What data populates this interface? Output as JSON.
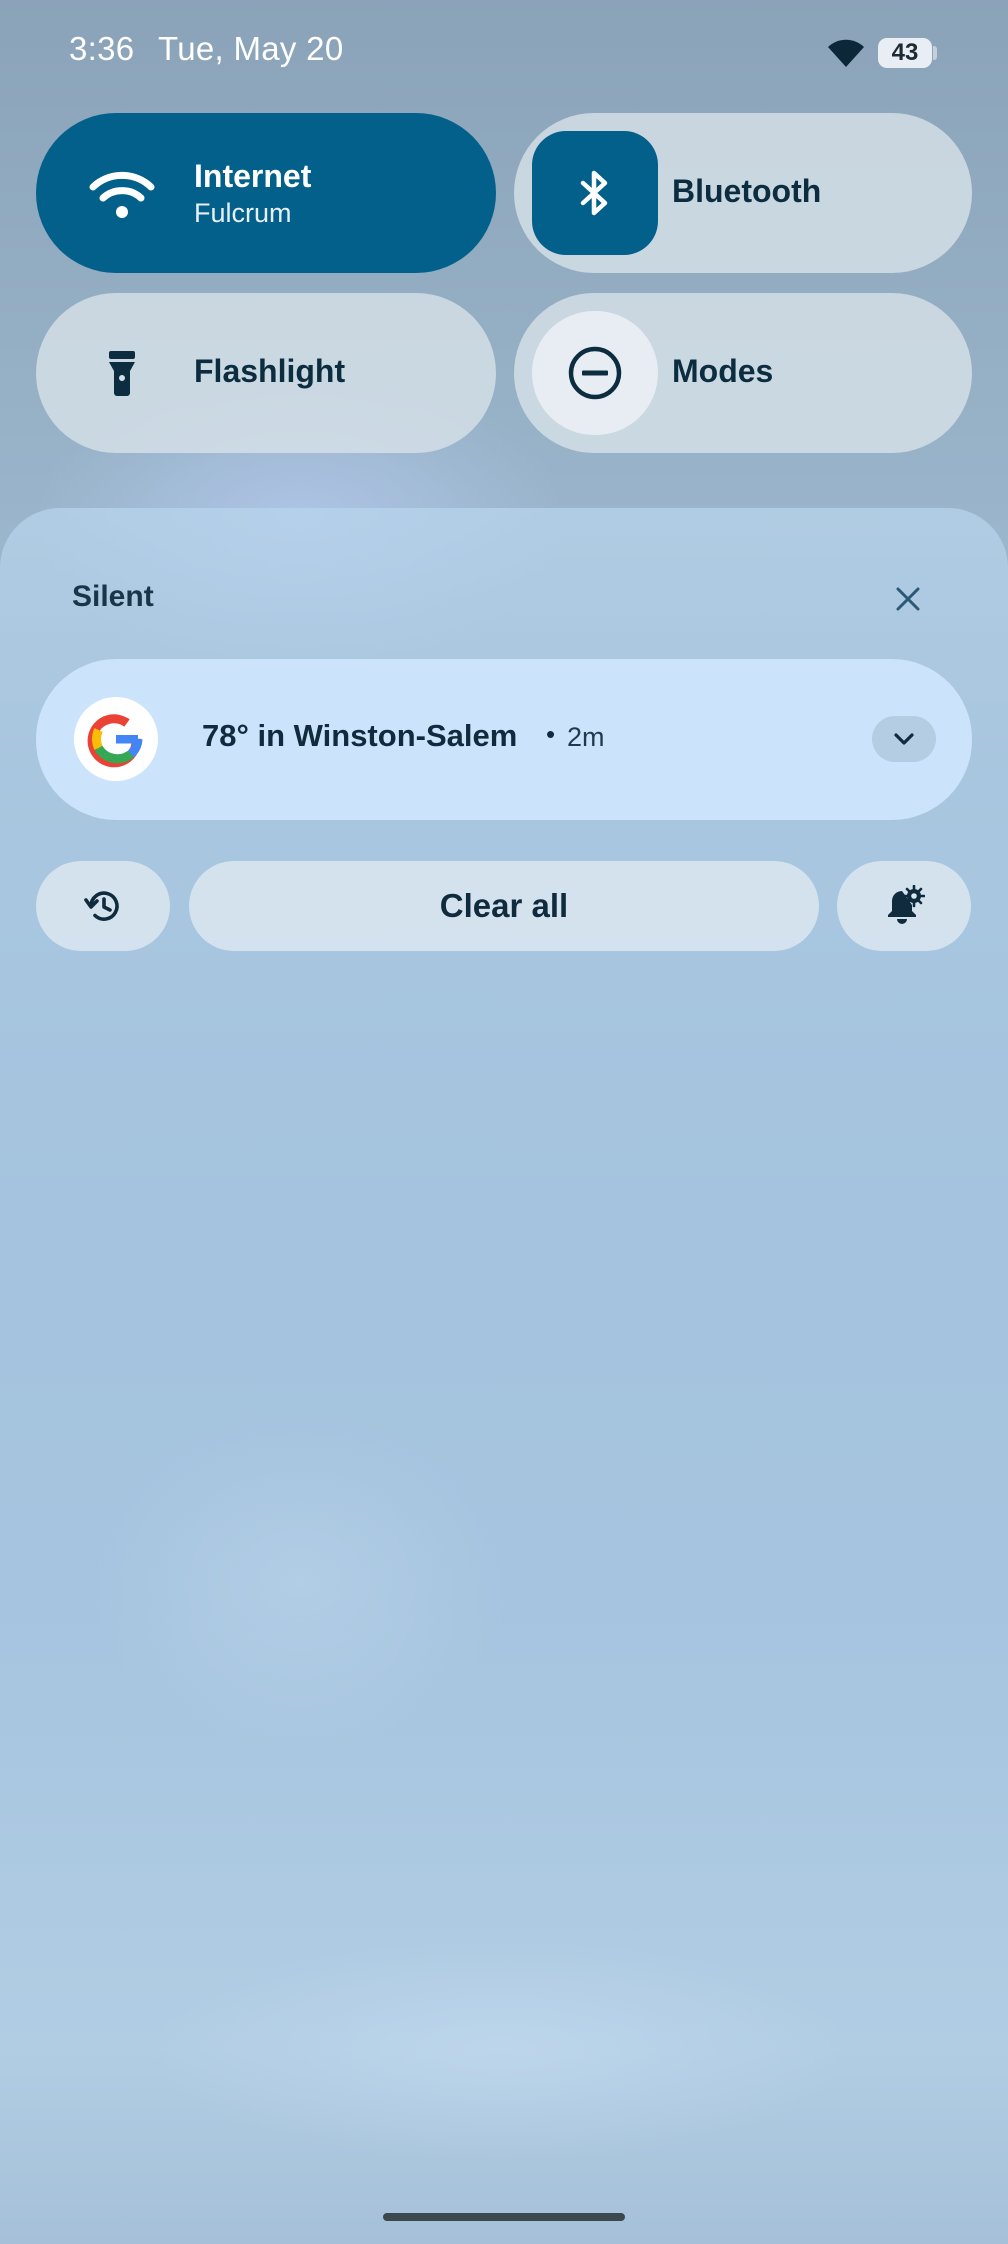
{
  "status_bar": {
    "time": "3:36",
    "date": "Tue, May 20",
    "battery_level": "43",
    "icons": [
      "wifi-icon",
      "battery-icon"
    ]
  },
  "quick_tiles": {
    "internet": {
      "label": "Internet",
      "subtitle": "Fulcrum",
      "icon": "wifi-icon",
      "active": true
    },
    "bluetooth": {
      "label": "Bluetooth",
      "icon": "bluetooth-icon",
      "active": true
    },
    "flashlight": {
      "label": "Flashlight",
      "icon": "flashlight-icon",
      "active": false
    },
    "modes": {
      "label": "Modes",
      "icon": "do-not-disturb-icon",
      "active": false
    }
  },
  "notifications": {
    "section_title": "Silent",
    "items": [
      {
        "app_icon": "google-g-icon",
        "title": "78° in Winston-Salem",
        "separator": "•",
        "time": "2m"
      }
    ],
    "actions": {
      "history_icon": "history-icon",
      "clear_all_label": "Clear all",
      "settings_icon": "notification-settings-icon"
    }
  },
  "colors": {
    "tile_active": "#03608a",
    "tile_inactive": "#d5e0e8",
    "notification_card": "#cce4fb",
    "text_dark": "#0f2b3d"
  }
}
